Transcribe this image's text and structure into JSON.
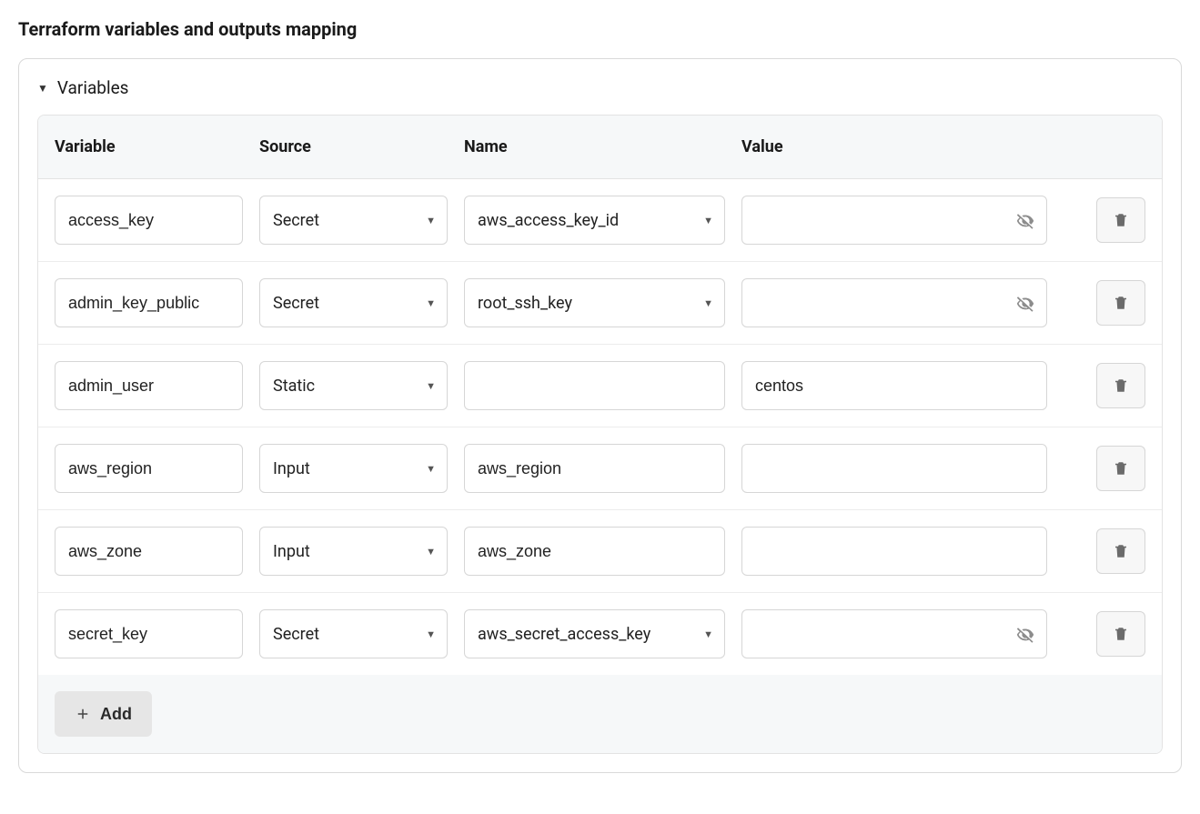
{
  "title": "Terraform variables and outputs mapping",
  "section": {
    "label": "Variables"
  },
  "columns": {
    "variable": "Variable",
    "source": "Source",
    "name": "Name",
    "value": "Value"
  },
  "rows": [
    {
      "variable": "access_key",
      "source": "Secret",
      "name": "aws_access_key_id",
      "name_is_select": true,
      "value": "",
      "value_masked": true
    },
    {
      "variable": "admin_key_public",
      "source": "Secret",
      "name": "root_ssh_key",
      "name_is_select": true,
      "value": "",
      "value_masked": true
    },
    {
      "variable": "admin_user",
      "source": "Static",
      "name": "",
      "name_is_select": false,
      "value": "centos",
      "value_masked": false
    },
    {
      "variable": "aws_region",
      "source": "Input",
      "name": "aws_region",
      "name_is_select": false,
      "value": "",
      "value_masked": false
    },
    {
      "variable": "aws_zone",
      "source": "Input",
      "name": "aws_zone",
      "name_is_select": false,
      "value": "",
      "value_masked": false
    },
    {
      "variable": "secret_key",
      "source": "Secret",
      "name": "aws_secret_access_key",
      "name_is_select": true,
      "value": "",
      "value_masked": true
    }
  ],
  "actions": {
    "add": "Add"
  }
}
